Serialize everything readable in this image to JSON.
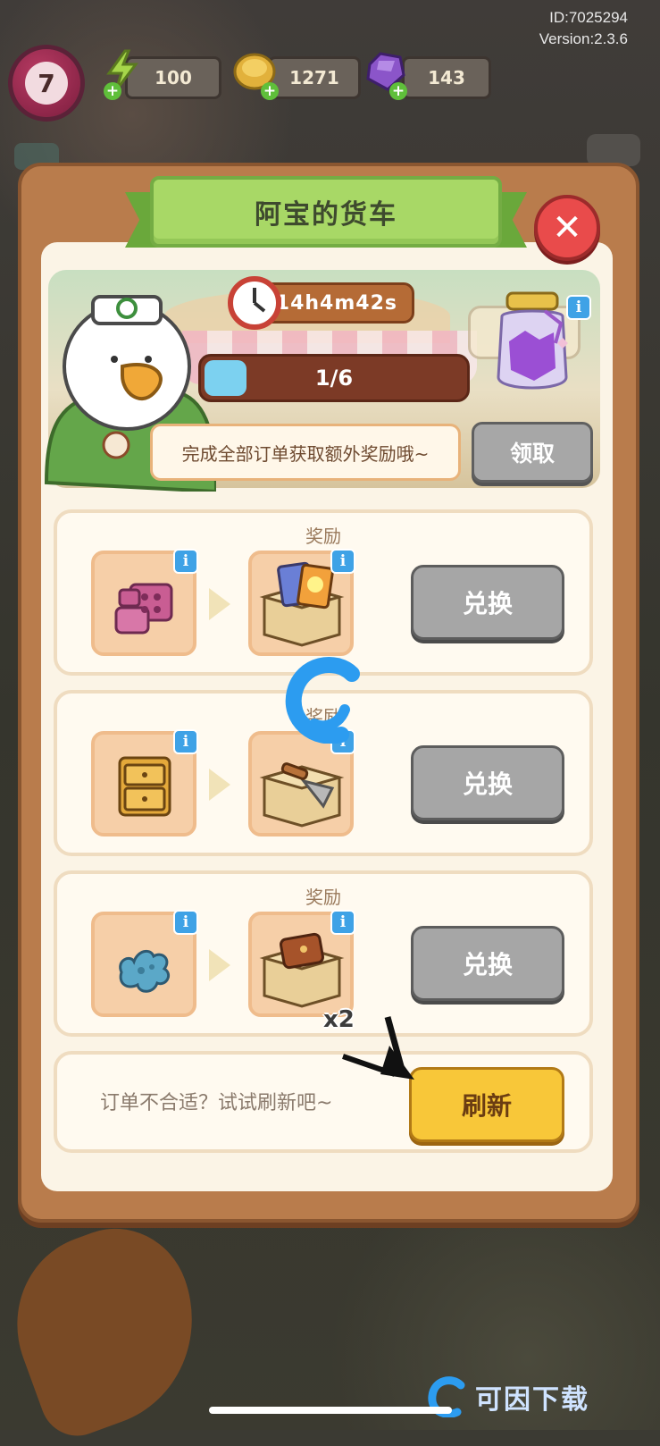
{
  "hud": {
    "player_id": "ID:7025294",
    "version": "Version:2.3.6",
    "level": "7",
    "energy": "100",
    "coins": "1271",
    "gems": "143"
  },
  "panel": {
    "title": "阿宝的货车",
    "timer": "14h4m42s",
    "progress": {
      "label": "1/6",
      "fraction": 0.1667
    },
    "hint": "完成全部订单获取额外奖励哦~",
    "claim_label": "领取"
  },
  "orders": [
    {
      "reward_label": "奖励",
      "input_icon": "pink-blocks-icon",
      "output_icon": "card-box-icon",
      "exchange_label": "兑换",
      "qty": ""
    },
    {
      "reward_label": "奖励",
      "input_icon": "wooden-drawer-icon",
      "output_icon": "trowel-box-icon",
      "exchange_label": "兑换",
      "qty": ""
    },
    {
      "reward_label": "奖励",
      "input_icon": "blue-puzzle-icon",
      "output_icon": "wallet-box-icon",
      "exchange_label": "兑换",
      "qty": "x2"
    }
  ],
  "refresh": {
    "hint": "订单不合适？试试刷新吧~",
    "button_label": "刷新"
  },
  "watermark": {
    "text": "可因下载"
  },
  "colors": {
    "panel": "#b97c4c",
    "title_ribbon": "#a8d866",
    "close": "#e94b4b",
    "refresh_button": "#f8c739",
    "exchange_button": "#a6a6a6",
    "info_badge": "#3fa2e6"
  }
}
